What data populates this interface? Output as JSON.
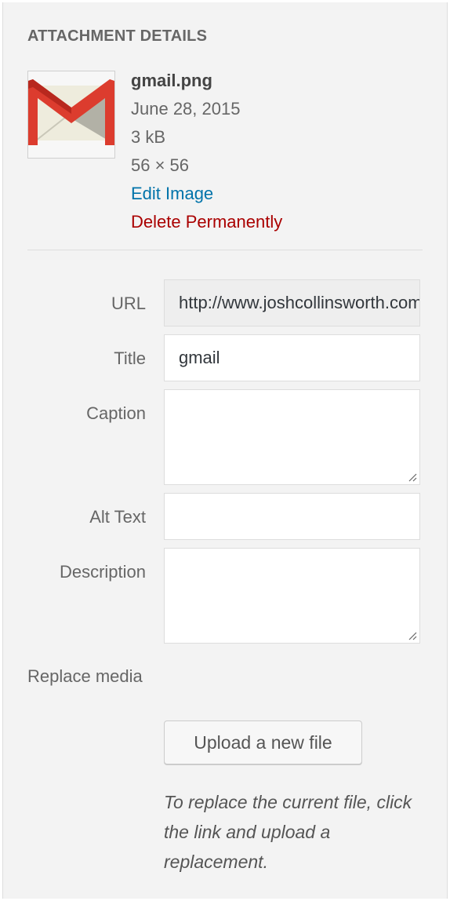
{
  "heading": "ATTACHMENT DETAILS",
  "thumbnail": {
    "icon": "gmail-logo-icon",
    "colors": {
      "red": "#dc3c2e",
      "envelope": "#eeecdd",
      "shade": "#b2b1a6"
    }
  },
  "file": {
    "name": "gmail.png",
    "date": "June 28, 2015",
    "size": "3 kB",
    "dimensions": "56 × 56",
    "edit_link": "Edit Image",
    "delete_link": "Delete Permanently"
  },
  "fields": {
    "url": {
      "label": "URL",
      "value": "http://www.joshcollinsworth.com/wp-content/uploads/gmail.png"
    },
    "title": {
      "label": "Title",
      "value": "gmail"
    },
    "caption": {
      "label": "Caption",
      "value": ""
    },
    "alt_text": {
      "label": "Alt Text",
      "value": ""
    },
    "description": {
      "label": "Description",
      "value": ""
    }
  },
  "replace": {
    "label": "Replace media",
    "button": "Upload a new file",
    "help": "To replace the current file, click the link and upload a replacement."
  },
  "colors": {
    "link": "#0073aa",
    "delete": "#aa0000",
    "panel_bg": "#f3f3f3"
  }
}
